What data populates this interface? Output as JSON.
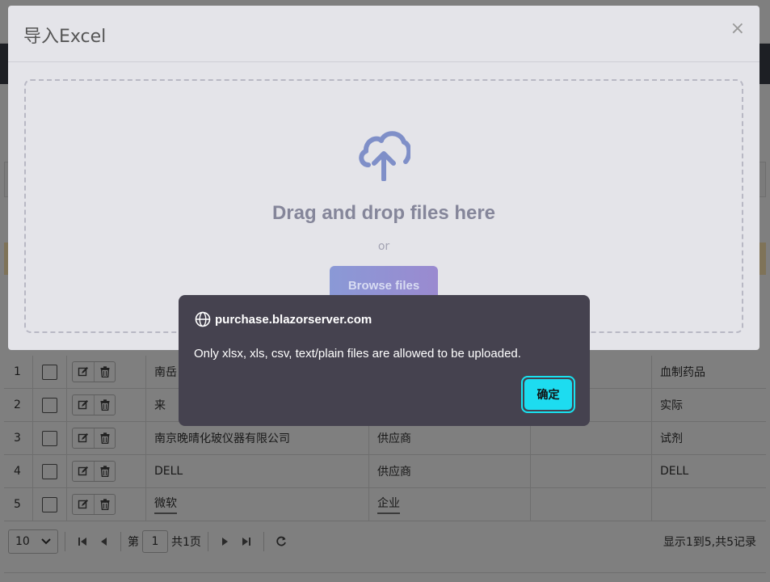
{
  "modal": {
    "title": "导入Excel",
    "close": "×",
    "dropzone": {
      "title": "Drag and drop files here",
      "or": "or",
      "browse": "Browse files"
    }
  },
  "alert": {
    "origin": "purchase.blazorserver.com",
    "message": "Only xlsx, xls, csv, text/plain files are allowed to be uploaded.",
    "ok": "确定"
  },
  "grid": {
    "rows": [
      {
        "num": "1",
        "name": "南岳",
        "type": "",
        "note": "血制药品"
      },
      {
        "num": "2",
        "name": "来",
        "type": "",
        "note": "实际"
      },
      {
        "num": "3",
        "name": "南京晚晴化玻仪器有限公司",
        "type": "供应商",
        "note": "试剂"
      },
      {
        "num": "4",
        "name": "DELL",
        "type": "供应商",
        "note": "DELL"
      },
      {
        "num": "5",
        "name": "微软",
        "type": "企业",
        "note": ""
      }
    ]
  },
  "pager": {
    "page_size": "10",
    "page_prefix": "第",
    "page_value": "1",
    "page_suffix": "共1页",
    "info": "显示1到5,共5记录"
  },
  "icons": {
    "globe": "globe-icon",
    "upload": "cloud-upload-icon",
    "edit": "edit-icon",
    "delete": "trash-icon"
  },
  "colors": {
    "accent_cyan": "#1ddcf0",
    "alert_bg": "#45424f",
    "browse_gradient_start": "#8a99d6",
    "browse_gradient_end": "#9a8ad0"
  }
}
